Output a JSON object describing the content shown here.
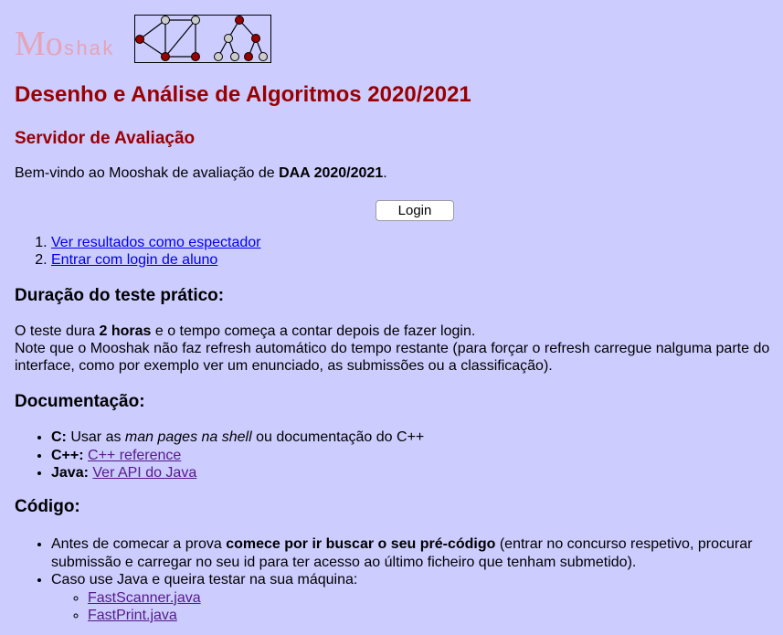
{
  "logo": {
    "brand_big": "Mo",
    "brand_small": "shak"
  },
  "title": "Desenho e Análise de Algoritmos 2020/2021",
  "subtitle": "Servidor de Avaliação",
  "welcome": {
    "prefix": "Bem-vindo ao Mooshak de avaliação de ",
    "bold": "DAA 2020/2021",
    "suffix": "."
  },
  "login_button": "Login",
  "links": [
    "Ver resultados como espectador",
    "Entrar com login de aluno"
  ],
  "duration": {
    "heading": "Duração do teste prático:",
    "line1_prefix": "O teste dura ",
    "line1_bold": "2 horas",
    "line1_suffix": " e o tempo começa a contar depois de fazer login.",
    "line2": "Note que o Mooshak não faz refresh automático do tempo restante (para forçar o refresh carregue nalguma parte do interface, como por exemplo ver um enunciado, as submissões ou a classificação)."
  },
  "documentation": {
    "heading": "Documentação:",
    "c_label": "C:",
    "c_text_prefix": " Usar as ",
    "c_text_italic": "man pages na shell",
    "c_text_suffix": " ou documentação do C++",
    "cpp_label": "C++:",
    "cpp_link": "C++ reference",
    "java_label": "Java:",
    "java_link": "Ver API do Java"
  },
  "code": {
    "heading": "Código:",
    "item1_prefix": "Antes de comecar a prova ",
    "item1_bold": "comece por ir buscar o seu pré-código",
    "item1_suffix": " (entrar no concurso respetivo, procurar submissão e carregar no seu id para ter acesso ao último ficheiro que tenham submetido).",
    "item2": "Caso use Java e queira testar na sua máquina:",
    "files": [
      "FastScanner.java",
      "FastPrint.java"
    ]
  },
  "colors": {
    "background": "#ccccff",
    "heading": "#990000",
    "link": "#0000ee",
    "visited_link": "#551a8b",
    "node_dark": "#990000",
    "node_light": "#cccccc"
  }
}
